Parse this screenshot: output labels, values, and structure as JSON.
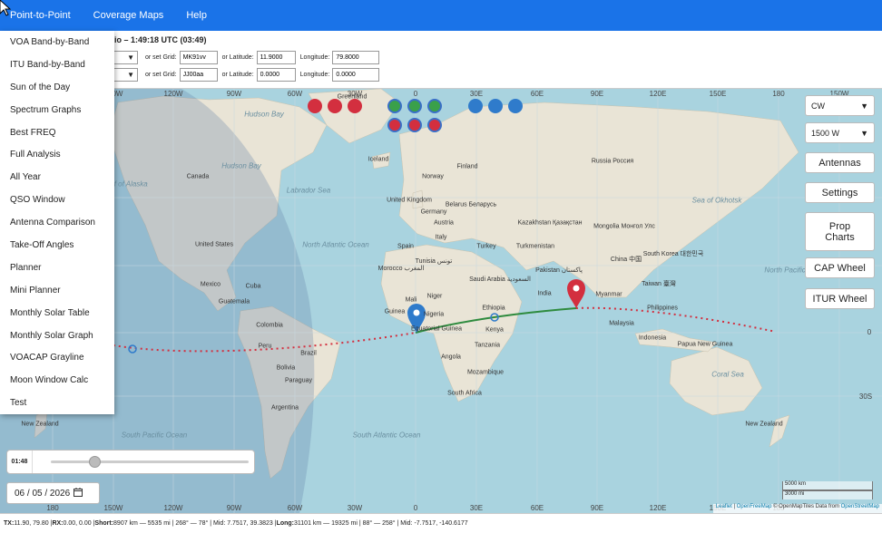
{
  "nav": {
    "items": [
      "Point-to-Point",
      "Coverage Maps",
      "Help"
    ]
  },
  "info": {
    "title": "io – 1:49:18 UTC (03:49)",
    "tx": {
      "select_arrow": "▼",
      "grid_label": "or set Grid:",
      "grid_value": "MK91vv",
      "lat_label": "or Latitude:",
      "lat_value": "11.9000",
      "lon_label": "Longitude:",
      "lon_value": "79.8000"
    },
    "rx": {
      "select_arrow": "▼",
      "grid_label": "or set Grid:",
      "grid_value": "JJ00aa",
      "lat_label": "or Latitude:",
      "lat_value": "0.0000",
      "lon_label": "Longitude:",
      "lon_value": "0.0000"
    }
  },
  "menu": {
    "items": [
      "VOA Band-by-Band",
      "ITU Band-by-Band",
      "Sun of the Day",
      "Spectrum Graphs",
      "Best FREQ",
      "Full Analysis",
      "All Year",
      "QSO Window",
      "Antenna Comparison",
      "Take-Off Angles",
      "Planner",
      "Mini Planner",
      "Monthly Solar Table",
      "Monthly Solar Graph",
      "VOACAP Grayline",
      "Moon Window Calc",
      "Test"
    ]
  },
  "controls": {
    "mode": "CW",
    "power": "1500 W",
    "arrow": "▼",
    "antennas": "Antennas",
    "settings": "Settings",
    "prop_charts_1": "Prop",
    "prop_charts_2": "Charts",
    "cap_wheel": "CAP Wheel",
    "itur_wheel": "ITUR Wheel"
  },
  "time_slider": {
    "label": "01:48",
    "position": 0.22
  },
  "date": {
    "value": "06 / 05 / 2026",
    "icon": "calendar-icon"
  },
  "scale": {
    "km": "5000 km",
    "mi": "3000 mi"
  },
  "attribution": {
    "leaflet": "Leaflet",
    "sep1": " | ",
    "osm": "OpenFreeMap",
    "rest": " © OpenMapTiles Data from ",
    "osm2": "OpenStreetMap"
  },
  "status": {
    "tx_label": "TX:",
    "tx_value": " 11.90, 79.80 | ",
    "rx_label": "RX:",
    "rx_value": " 0.00, 0.00 | ",
    "short_label": "Short:",
    "short_value": " 8907 km — 5535 mi | 268° — 78° | Mid: 7.7517, 39.3823 | ",
    "long_label": "Long:",
    "long_value": " 31101 km — 19325 mi | 88° — 258° | Mid: -7.7517, -140.6177"
  },
  "map": {
    "top_lon_labels": [
      "150W",
      "120W",
      "90W",
      "60W",
      "30W",
      "0",
      "30E",
      "60E",
      "90E",
      "120E",
      "150E",
      "180",
      "150W"
    ],
    "bottom_lon_labels": [
      "180",
      "150W",
      "120W",
      "90W",
      "60W",
      "30W",
      "0",
      "30E",
      "60E",
      "90E",
      "120E",
      "150E",
      "180"
    ],
    "lat_labels": [
      "0",
      "30S"
    ],
    "ocean_labels": [
      "Hudson Bay",
      "Hudson Bay",
      "Gulf of Alaska",
      "Labrador Sea",
      "North Atlantic Ocean",
      "Sea of Okhotsk",
      "North Pacific Ocean",
      "Coral Sea",
      "South Pacific Ocean",
      "South Atlantic Ocean"
    ],
    "place_labels": [
      "Greenland",
      "Iceland",
      "Canada",
      "Norway",
      "Finland",
      "Russia Россия",
      "United Kingdom",
      "Belarus Беларусь",
      "Germany",
      "Austria",
      "Italy",
      "Kazakhstan Қазақстан",
      "Mongolia Монгол Улс",
      "United States",
      "Spain",
      "Turkey",
      "Turkmenistan",
      "China 中国",
      "South Korea 대한민국",
      "Morocco المغرب",
      "Tunisia تونس",
      "Saudi Arabia السعودية",
      "Pakistan پاکستان",
      "Mexico",
      "Cuba",
      "Taiwan 臺灣",
      "Mali",
      "Niger",
      "Myanmar",
      "Guatemala",
      "Ethiopia",
      "Philippines",
      "Colombia",
      "Guinea",
      "Nigeria",
      "Equatorial Guinea",
      "Kenya",
      "Malaysia",
      "Peru",
      "Brazil",
      "Tanzania",
      "Indonesia",
      "Papua New Guinea",
      "Angola",
      "Bolivia",
      "Mozambique",
      "Paraguay",
      "South Africa",
      "Argentina",
      "New Zealand",
      "New Zealand",
      "India"
    ]
  },
  "colors": {
    "nav": "#1a73e8",
    "ocean": "#a9d3df",
    "land": "#e9e4d6",
    "night": "#8aa8c7",
    "short_path": "#2e8b3e",
    "long_path": "#d32f3f",
    "tx_marker": "#d32f3f",
    "rx_marker": "#2f7bcb"
  }
}
